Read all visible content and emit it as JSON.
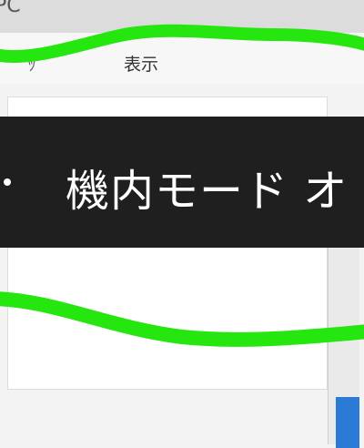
{
  "window": {
    "title": "PC"
  },
  "ribbon": {
    "arrow_label": "ｯ",
    "view_label": "表示"
  },
  "nav": {
    "pc_label": "PC"
  },
  "toast": {
    "text": "機内モード オ"
  },
  "icons": {
    "pc": "computer-icon",
    "arrow": "chevron-icon"
  },
  "colors": {
    "toast_bg": "#1f1f1f",
    "highlight": "#2a7ad6",
    "scribble": "#26e60f"
  }
}
